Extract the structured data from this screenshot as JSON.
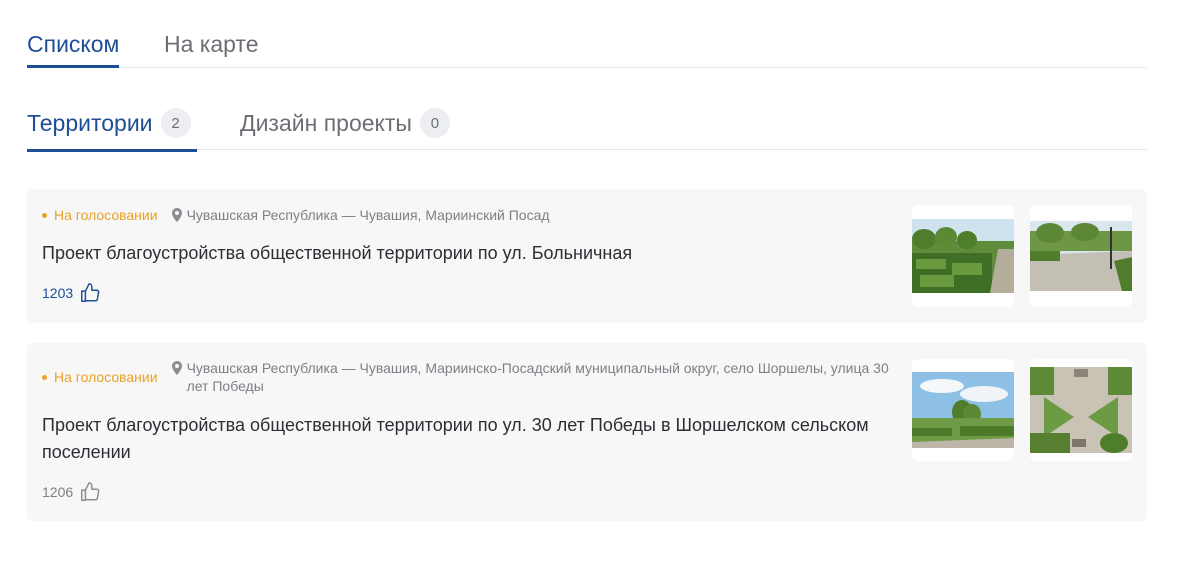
{
  "view_tabs": [
    {
      "label": "Списком",
      "active": true
    },
    {
      "label": "На карте",
      "active": false
    }
  ],
  "sub_tabs": [
    {
      "label": "Территории",
      "count": "2",
      "active": true
    },
    {
      "label": "Дизайн проекты",
      "count": "0",
      "active": false
    }
  ],
  "projects": [
    {
      "status": "На голосовании",
      "location": "Чувашская Республика — Чувашия, Мариинский Посад",
      "title": "Проект благоустройства общественной территории по ул. Больничная",
      "likes": "1203",
      "liked": true,
      "photos": [
        "park-hedges-photo",
        "park-path-photo"
      ]
    },
    {
      "status": "На голосовании",
      "location": "Чувашская Республика — Чувашия, Мариинско-Посадский муниципальный округ, село Шоршелы, улица 30 лет Победы",
      "title": "Проект благоустройства общественной территории по ул. 30 лет Победы в Шоршелском сельском поселении",
      "likes": "1206",
      "liked": false,
      "photos": [
        "park-sky-photo",
        "park-aerial-photo"
      ]
    }
  ],
  "colors": {
    "accent": "#1d4e96",
    "status": "#e9a12a",
    "muted": "#7d8187",
    "card_bg": "#f7f7f7"
  }
}
